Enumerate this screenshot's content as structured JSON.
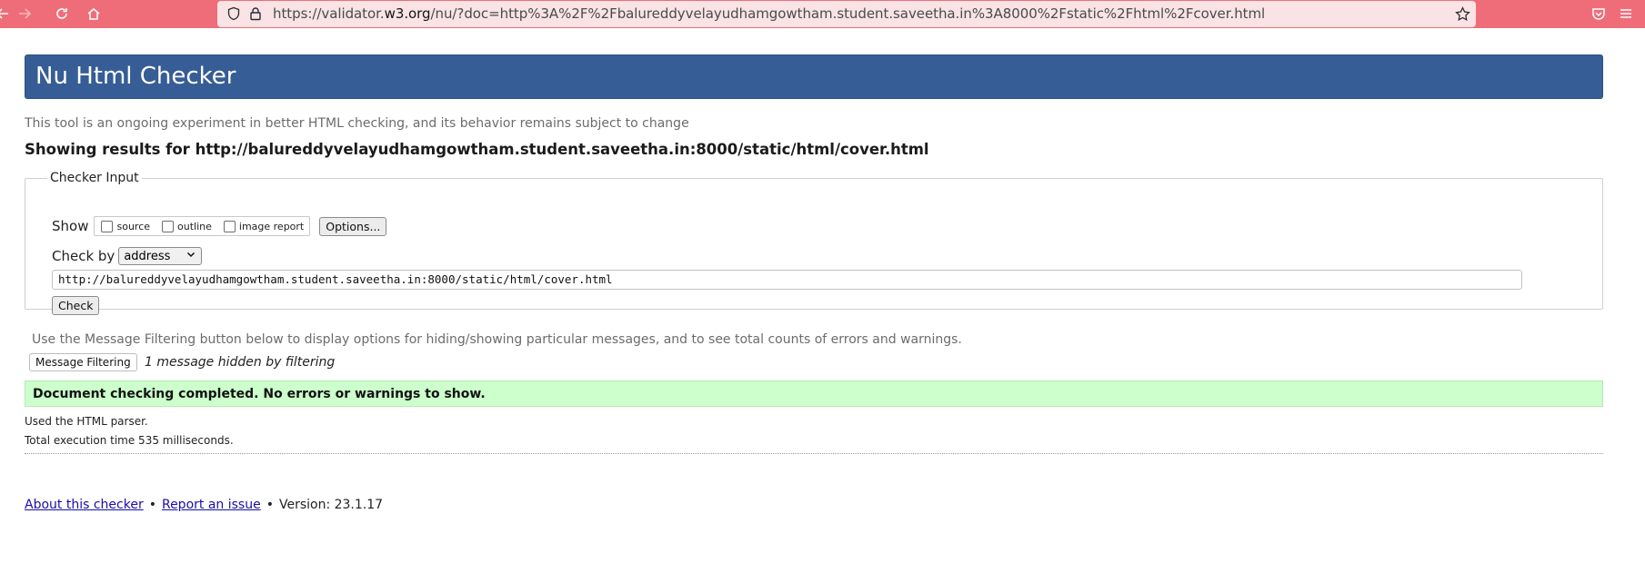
{
  "browser": {
    "url_prefix": "https://validator.",
    "url_domain": "w3.org",
    "url_suffix": "/nu/?doc=http%3A%2F%2Fbalureddyvelayudhamgowtham.student.saveetha.in%3A8000%2Fstatic%2Fhtml%2Fcover.html",
    "icons": [
      "arrow-left-icon",
      "arrow-right-icon",
      "reload-icon",
      "home-icon",
      "shield-icon",
      "lock-icon",
      "star-icon",
      "pocket-icon",
      "menu-icon"
    ]
  },
  "page": {
    "title": "Nu Html Checker",
    "intro": "This tool is an ongoing experiment in better HTML checking, and its behavior remains subject to change",
    "showing_results": "Showing results for http://balureddyvelayudhamgowtham.student.saveetha.in:8000/static/html/cover.html"
  },
  "checker_input": {
    "legend": "Checker Input",
    "show_label": "Show",
    "checkboxes": [
      "source",
      "outline",
      "image report"
    ],
    "options_button": "Options...",
    "check_by_label": "Check by",
    "check_by_value": "address",
    "address_value": "http://balureddyvelayudhamgowtham.student.saveetha.in:8000/static/html/cover.html",
    "check_button": "Check"
  },
  "filtering": {
    "info": "Use the Message Filtering button below to display options for hiding/showing particular messages, and to see total counts of errors and warnings.",
    "button": "Message Filtering",
    "hidden_note": "1 message hidden by filtering"
  },
  "result": {
    "success": "Document checking completed. No errors or warnings to show.",
    "parser": "Used the HTML parser.",
    "exec_time": "Total execution time 535 milliseconds."
  },
  "footer": {
    "about": "About this checker",
    "separator": "•",
    "report": "Report an issue",
    "version": "Version: 23.1.17"
  },
  "colors": {
    "toolbar": "#ef6d79",
    "banner": "#365d95",
    "success_bg": "#ccffcc"
  }
}
